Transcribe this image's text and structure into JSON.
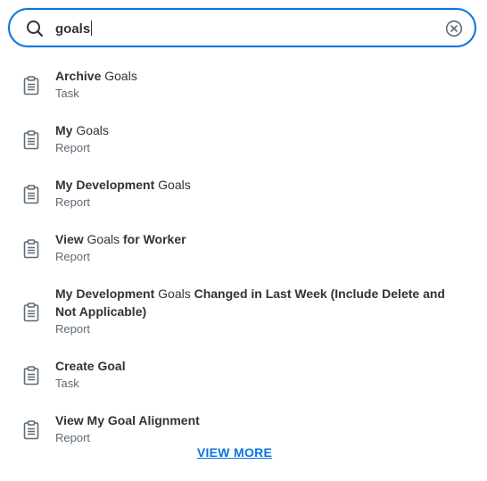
{
  "search": {
    "query": "goals"
  },
  "results": [
    {
      "title_parts": [
        {
          "text": "Archive ",
          "light": false
        },
        {
          "text": "Goals",
          "light": true
        }
      ],
      "type": "Task"
    },
    {
      "title_parts": [
        {
          "text": "My ",
          "light": false
        },
        {
          "text": "Goals",
          "light": true
        }
      ],
      "type": "Report"
    },
    {
      "title_parts": [
        {
          "text": "My Development ",
          "light": false
        },
        {
          "text": "Goals",
          "light": true
        }
      ],
      "type": "Report"
    },
    {
      "title_parts": [
        {
          "text": "View ",
          "light": false
        },
        {
          "text": "Goals",
          "light": true
        },
        {
          "text": " for Worker",
          "light": false
        }
      ],
      "type": "Report"
    },
    {
      "title_parts": [
        {
          "text": "My Development ",
          "light": false
        },
        {
          "text": "Goals",
          "light": true
        },
        {
          "text": " Changed in Last Week (Include Delete and Not Applicable)",
          "light": false
        }
      ],
      "type": "Report"
    },
    {
      "title_parts": [
        {
          "text": "Create Goal",
          "light": false
        }
      ],
      "type": "Task"
    },
    {
      "title_parts": [
        {
          "text": "View My Goal Alignment",
          "light": false
        }
      ],
      "type": "Report"
    }
  ],
  "footer": {
    "view_more_label": "VIEW MORE"
  },
  "colors": {
    "accent": "#0875e1",
    "text": "#333333",
    "subtext": "#5e6a75",
    "icon": "#5e6a75"
  },
  "icons": {
    "search": "search-icon",
    "clear": "clear-circle-x-icon",
    "result": "clipboard-icon"
  }
}
